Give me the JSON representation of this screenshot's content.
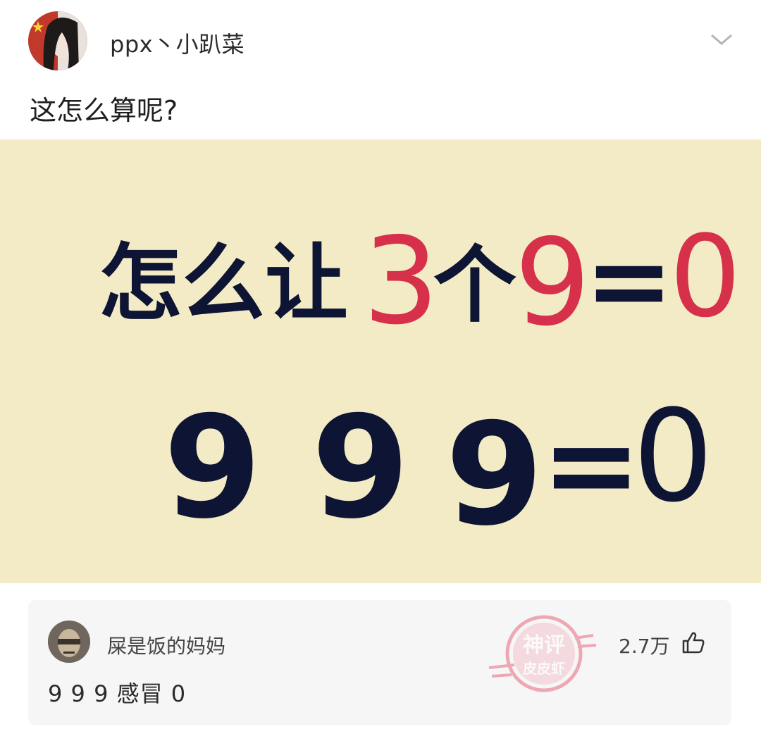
{
  "post": {
    "author": "ppx丶小趴菜",
    "text": "这怎么算呢?",
    "image": {
      "line1_prefix": "怎么让",
      "line1_three": "3",
      "line1_ge": "个",
      "line1_nine": "9",
      "line1_eq": "=",
      "line1_zero": "0",
      "line2": [
        "9",
        "9",
        "9",
        "=",
        "0"
      ]
    }
  },
  "comment": {
    "author": "屎是饭的妈妈",
    "text": "9 9 9 感冒 0",
    "likes": "2.7万",
    "stamp_top": "神评",
    "stamp_bottom": "皮皮虾"
  },
  "colors": {
    "accent_red": "#d6304a",
    "ink": "#0e1433",
    "paper": "#f3ebc6"
  },
  "icons": {
    "menu": "chevron-down-icon",
    "like": "thumbs-up-icon"
  }
}
